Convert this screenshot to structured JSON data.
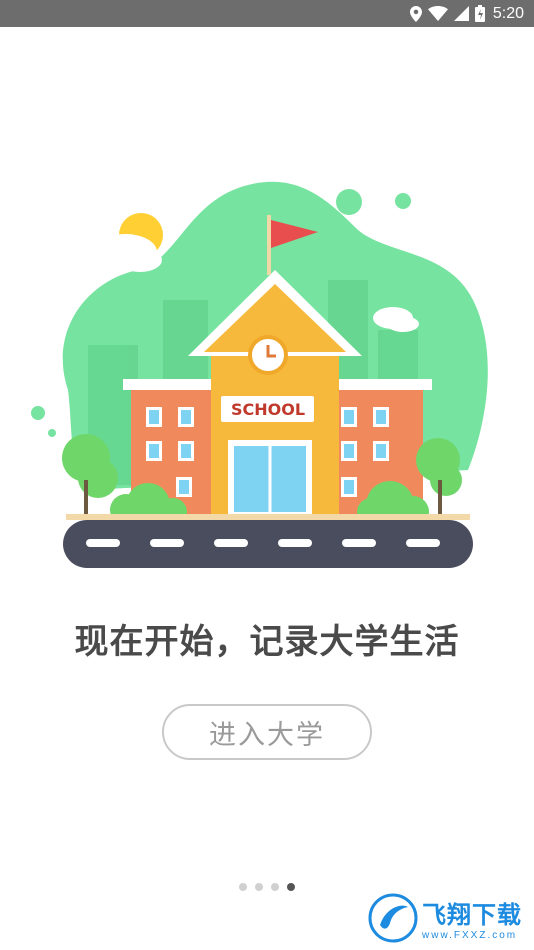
{
  "status_bar": {
    "time": "5:20",
    "icons": [
      "location-icon",
      "wifi-icon",
      "signal-icon",
      "battery-icon"
    ]
  },
  "illustration": {
    "sign_text": "SCHOOL",
    "colors": {
      "blob": "#77e3a0",
      "building": "#f6b93b",
      "wing": "#e8744a",
      "road": "#4a4d5e",
      "flag": "#e84e4e"
    }
  },
  "headline": "现在开始，记录大学生活",
  "enter_button": "进入大学",
  "pager": {
    "count": 4,
    "active_index": 3
  },
  "watermark": {
    "title": "飞翔下载",
    "subtitle": "www.FXXZ.com"
  }
}
